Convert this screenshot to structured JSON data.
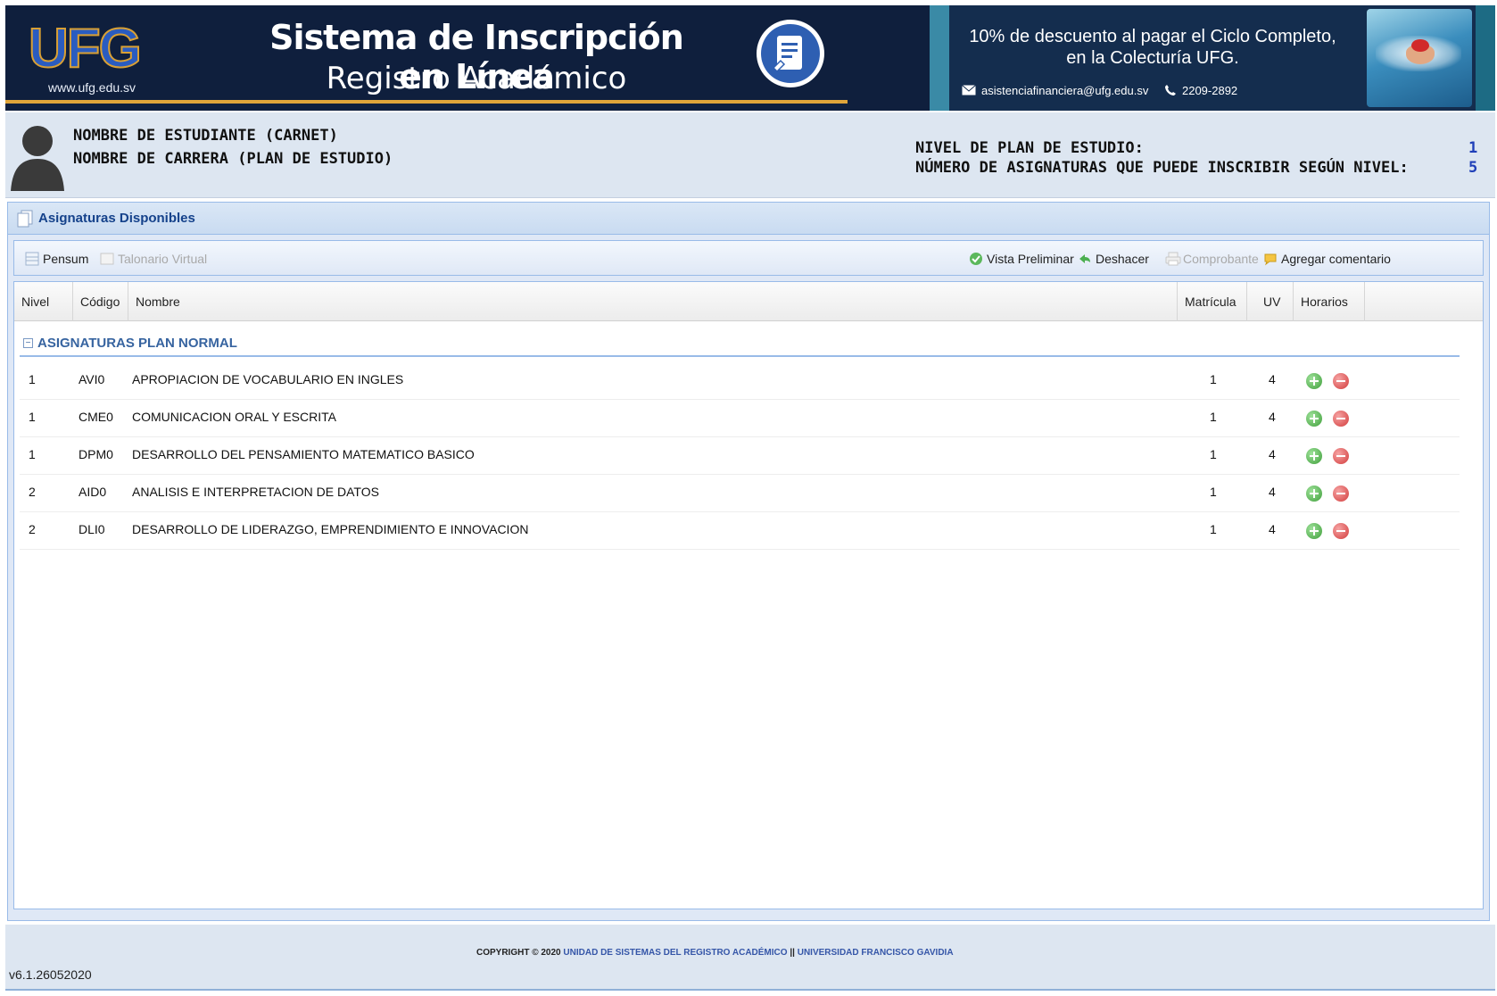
{
  "banner": {
    "logo_text": "UFG",
    "logo_url": "www.ufg.edu.sv",
    "title": "Sistema de Inscripción en Línea",
    "subtitle": "Registro Académico",
    "promo_line1": "10% de descuento al pagar el Ciclo Completo,",
    "promo_line2": "en la Colecturía UFG.",
    "promo_email": "asistenciafinanciera@ufg.edu.sv",
    "promo_phone": "2209-2892",
    "colors": {
      "primary": "#0f1f3d",
      "accent": "#e0a53a",
      "promo_bg": "#142d4e"
    }
  },
  "student": {
    "name": "NOMBRE DE ESTUDIANTE (CARNET)",
    "career": "NOMBRE DE CARRERA (PLAN DE ESTUDIO)",
    "level_label": "NIVEL DE PLAN DE ESTUDIO:",
    "level_value": "1",
    "max_label": "NÚMERO DE ASIGNATURAS QUE PUEDE INSCRIBIR SEGÚN NIVEL:",
    "max_value": "5"
  },
  "panel": {
    "title": "Asignaturas Disponibles"
  },
  "toolbar": {
    "pensum": "Pensum",
    "talonario": "Talonario Virtual",
    "vista_preliminar": "Vista Preliminar",
    "deshacer": "Deshacer",
    "comprobante": "Comprobante",
    "agregar_comentario": "Agregar comentario"
  },
  "grid": {
    "columns": {
      "nivel": "Nivel",
      "codigo": "Código",
      "nombre": "Nombre",
      "matricula": "Matrícula",
      "uv": "UV",
      "horarios": "Horarios"
    },
    "group_label": "ASIGNATURAS PLAN NORMAL",
    "rows": [
      {
        "nivel": "1",
        "codigo": "AVI0",
        "nombre": "APROPIACION DE VOCABULARIO EN INGLES",
        "matricula": "1",
        "uv": "4"
      },
      {
        "nivel": "1",
        "codigo": "CME0",
        "nombre": "COMUNICACION ORAL Y ESCRITA",
        "matricula": "1",
        "uv": "4"
      },
      {
        "nivel": "1",
        "codigo": "DPM0",
        "nombre": "DESARROLLO DEL PENSAMIENTO MATEMATICO BASICO",
        "matricula": "1",
        "uv": "4"
      },
      {
        "nivel": "2",
        "codigo": "AID0",
        "nombre": "ANALISIS E INTERPRETACION DE DATOS",
        "matricula": "1",
        "uv": "4"
      },
      {
        "nivel": "2",
        "codigo": "DLI0",
        "nombre": "DESARROLLO DE LIDERAZGO, EMPRENDIMIENTO E INNOVACION",
        "matricula": "1",
        "uv": "4"
      }
    ]
  },
  "footer": {
    "version": "v6.1.26052020",
    "copyright_prefix": "COPYRIGHT © 2020",
    "link1": "UNIDAD DE SISTEMAS DEL REGISTRO ACADÉMICO",
    "separator": "||",
    "link2": "UNIVERSIDAD FRANCISCO GAVIDIA"
  }
}
